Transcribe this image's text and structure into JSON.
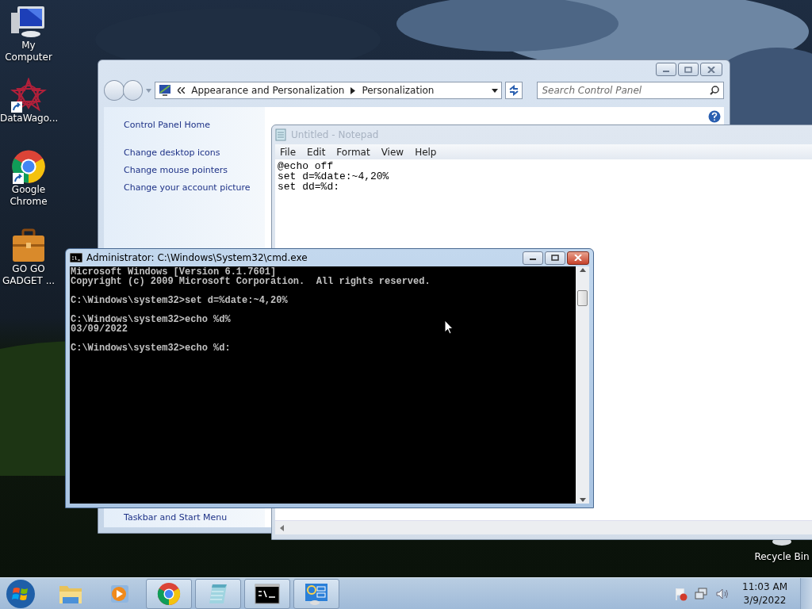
{
  "desktop_icons": [
    {
      "kind": "computer",
      "label": "My Computer",
      "shortcut": false
    },
    {
      "kind": "star",
      "label": "DataWago...",
      "shortcut": true
    },
    {
      "kind": "chrome",
      "label": "Google Chrome",
      "shortcut": true
    },
    {
      "kind": "briefcase",
      "label": "GO GO GADGET ...",
      "shortcut": false
    }
  ],
  "recycle_bin": {
    "label": "Recycle Bin"
  },
  "control_panel": {
    "breadcrumb": [
      "Appearance and Personalization",
      "Personalization"
    ],
    "search": {
      "placeholder": "Search Control Panel"
    },
    "links": [
      "Control Panel Home",
      "Change desktop icons",
      "Change mouse pointers",
      "Change your account picture"
    ],
    "bottom_link": "Taskbar and Start Menu"
  },
  "notepad": {
    "title": "Untitled - Notepad",
    "active": false,
    "menu": [
      "File",
      "Edit",
      "Format",
      "View",
      "Help"
    ],
    "lines": [
      "@echo off",
      "set d=%date:~4,20%",
      "set dd=%d:"
    ]
  },
  "cmd": {
    "title": "Administrator: C:\\Windows\\System32\\cmd.exe",
    "active": true,
    "blocks": [
      [
        "Microsoft Windows [Version 6.1.7601]",
        "Copyright (c) 2009 Microsoft Corporation.  All rights reserved."
      ],
      [
        "C:\\Windows\\system32>set d=%date:~4,20%"
      ],
      [
        "C:\\Windows\\system32>echo %d%",
        "03/09/2022"
      ],
      [
        "C:\\Windows\\system32>echo %d:"
      ]
    ]
  },
  "taskbar": {
    "items": [
      {
        "kind": "start",
        "open": false
      },
      {
        "kind": "explorer",
        "open": false
      },
      {
        "kind": "media",
        "open": false
      },
      {
        "kind": "chrome",
        "open": true
      },
      {
        "kind": "notepad",
        "open": true
      },
      {
        "kind": "cmd",
        "open": true
      },
      {
        "kind": "control",
        "open": true
      }
    ],
    "clock": {
      "time": "11:03 AM",
      "date": "3/9/2022"
    }
  }
}
